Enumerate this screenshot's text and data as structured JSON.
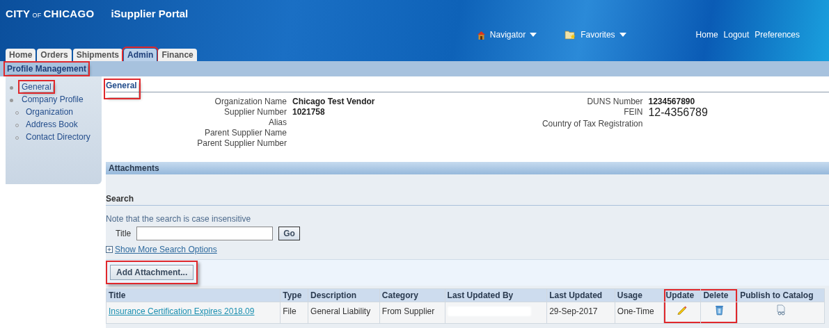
{
  "header": {
    "logo": [
      "CITY",
      "OF",
      "CHICAGO"
    ],
    "app_title": "iSupplier Portal",
    "menus": [
      {
        "label": "Navigator",
        "kind": "home"
      },
      {
        "label": "Favorites",
        "kind": "favorites"
      }
    ],
    "links": [
      "Home",
      "Logout",
      "Preferences"
    ]
  },
  "tabs": [
    {
      "label": "Home",
      "selected": false,
      "highlighted": false
    },
    {
      "label": "Orders",
      "selected": false,
      "highlighted": false
    },
    {
      "label": "Shipments",
      "selected": false,
      "highlighted": false
    },
    {
      "label": "Admin",
      "selected": true,
      "highlighted": true
    },
    {
      "label": "Finance",
      "selected": false,
      "highlighted": false
    }
  ],
  "subnav": {
    "title": "Profile Management",
    "highlighted": true
  },
  "sidebar": {
    "items": [
      {
        "label": "General",
        "highlighted": true
      },
      {
        "label": "Company Profile",
        "highlighted": false,
        "children": [
          {
            "label": "Organization"
          },
          {
            "label": "Address Book"
          },
          {
            "label": "Contact Directory"
          }
        ]
      }
    ]
  },
  "profile": {
    "heading": {
      "text": "General",
      "highlighted": true
    },
    "left_fields": [
      {
        "label": "Organization Name",
        "value": "Chicago Test Vendor",
        "kind": "bold"
      },
      {
        "label": "Supplier Number",
        "value": "1021758",
        "kind": "bold"
      },
      {
        "label": "Alias"
      },
      {
        "label": "Parent Supplier Name"
      },
      {
        "label": "Parent Supplier Number"
      }
    ],
    "right_fields": [
      {
        "label": "DUNS Number",
        "value": "1234567890",
        "kind": "bold"
      },
      {
        "label": "FEIN",
        "value": "12-4356789",
        "kind": "large"
      },
      {
        "label": "Country of Tax Registration"
      }
    ]
  },
  "attachments": {
    "title": "Attachments",
    "search": {
      "title": "Search",
      "note": "Note that the search is case insensitive",
      "field_label": "Title",
      "go_button": "Go",
      "more_options": "Show More Search Options"
    },
    "add_button": {
      "label": "Add Attachment...",
      "highlighted": true
    },
    "table": {
      "columns": [
        {
          "label": "Title",
          "highlighted": false
        },
        {
          "label": "Type",
          "highlighted": false
        },
        {
          "label": "Description",
          "highlighted": false
        },
        {
          "label": "Category",
          "highlighted": false
        },
        {
          "label": "Last Updated By",
          "highlighted": false
        },
        {
          "label": "Last Updated",
          "highlighted": false
        },
        {
          "label": "Usage",
          "highlighted": false
        },
        {
          "label": "Update",
          "highlighted": true
        },
        {
          "label": "Delete",
          "highlighted": true
        },
        {
          "label": "Publish to Catalog",
          "highlighted": false
        }
      ],
      "rows": [
        {
          "cells": [
            {
              "kind": "link",
              "text": "Insurance Certification Expires 2018.09"
            },
            {
              "kind": "text",
              "text": "File"
            },
            {
              "kind": "text",
              "text": "General Liability"
            },
            {
              "kind": "text",
              "text": "From Supplier"
            },
            {
              "kind": "redacted"
            },
            {
              "kind": "text",
              "text": "29-Sep-2017"
            },
            {
              "kind": "text",
              "text": "One-Time"
            },
            {
              "kind": "edit"
            },
            {
              "kind": "delete"
            },
            {
              "kind": "publish"
            }
          ]
        }
      ]
    }
  }
}
